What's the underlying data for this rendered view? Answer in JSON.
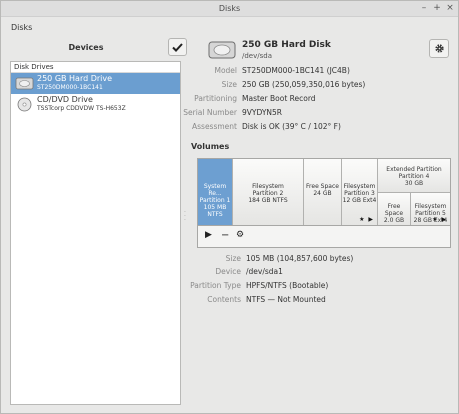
{
  "window": {
    "title": "Disks"
  },
  "menu": {
    "label": "Disks"
  },
  "sidebar": {
    "title": "Devices",
    "group": "Disk Drives",
    "devices": [
      {
        "name": "250 GB Hard Drive",
        "model": "ST250DM000-1BC141",
        "icon": "harddisk-icon",
        "selected": true
      },
      {
        "name": "CD/DVD Drive",
        "model": "TSSTcorp CDDVDW TS-H653Z",
        "icon": "optical-drive-icon",
        "selected": false
      }
    ]
  },
  "disk": {
    "title": "250 GB Hard Disk",
    "device": "/dev/sda",
    "props": [
      {
        "key": "Model",
        "value": "ST250DM000-1BC141 (JC4B)"
      },
      {
        "key": "Size",
        "value": "250 GB (250,059,350,016 bytes)"
      },
      {
        "key": "Partitioning",
        "value": "Master Boot Record"
      },
      {
        "key": "Serial Number",
        "value": "9VYDYN5R"
      },
      {
        "key": "Assessment",
        "value": "Disk is OK (39° C / 102° F)"
      }
    ]
  },
  "volumes": {
    "title": "Volumes",
    "segments": [
      {
        "lines": [
          "System Re...",
          "Partition 1",
          "105 MB NTFS"
        ],
        "selected": true
      },
      {
        "lines": [
          "Filesystem",
          "Partition 2",
          "184 GB NTFS"
        ],
        "selected": false
      },
      {
        "lines": [
          "Free Space",
          "24 GB"
        ],
        "selected": false
      },
      {
        "lines": [
          "Filesystem",
          "Partition 3",
          "12 GB Ext4"
        ],
        "selected": false,
        "marks": "★ ▶"
      }
    ],
    "extended": {
      "lines": [
        "Extended Partition",
        "Partition 4",
        "30 GB"
      ]
    },
    "logical": [
      {
        "lines": [
          "Free Space",
          "2.0 GB"
        ]
      },
      {
        "lines": [
          "Filesystem",
          "Partition 5",
          "28 GB Ext4"
        ],
        "marks": "★ ▶"
      }
    ],
    "toolbar": {
      "play": "▶",
      "remove": "−",
      "settings": "⚙"
    }
  },
  "partition": {
    "props": [
      {
        "key": "Size",
        "value": "105 MB (104,857,600 bytes)"
      },
      {
        "key": "Device",
        "value": "/dev/sda1"
      },
      {
        "key": "Partition Type",
        "value": "HPFS/NTFS (Bootable)"
      },
      {
        "key": "Contents",
        "value": "NTFS — Not Mounted"
      }
    ]
  },
  "colors": {
    "selection": "#6b9ed0",
    "background": "#e8e8e7"
  }
}
